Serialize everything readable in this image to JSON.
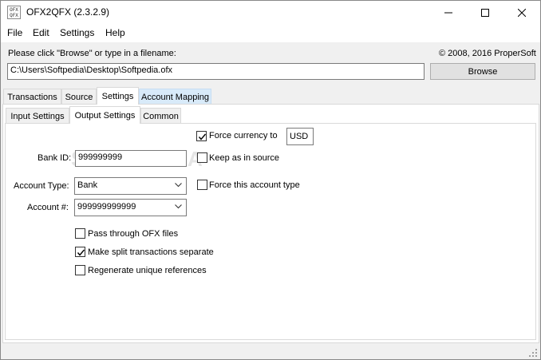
{
  "window": {
    "title": "OFX2QFX (2.3.2.9)",
    "icon_text_top": "OFX",
    "icon_text_bottom": "QFX"
  },
  "menu": [
    "File",
    "Edit",
    "Settings",
    "Help"
  ],
  "file": {
    "prompt": "Please click \"Browse\" or type in a filename:",
    "copyright": "© 2008, 2016 ProperSoft",
    "path": "C:\\Users\\Softpedia\\Desktop\\Softpedia.ofx",
    "browse_label": "Browse"
  },
  "main_tabs": [
    "Transactions",
    "Source",
    "Settings",
    "Account Mapping"
  ],
  "sub_tabs": [
    "Input Settings",
    "Output Settings",
    "Common"
  ],
  "output": {
    "force_currency_label": "Force currency to",
    "force_currency_checked": true,
    "currency_value": "USD",
    "bank_id_label": "Bank ID:",
    "bank_id_value": "999999999",
    "keep_source_label": "Keep as in source",
    "keep_source_checked": false,
    "account_type_label": "Account Type:",
    "account_type_value": "Bank",
    "force_account_type_label": "Force this account type",
    "force_account_type_checked": false,
    "account_num_label": "Account #:",
    "account_num_value": "999999999999",
    "pass_through_label": "Pass through OFX files",
    "pass_through_checked": false,
    "split_label": "Make split transactions separate",
    "split_checked": true,
    "regenerate_label": "Regenerate unique references",
    "regenerate_checked": false
  },
  "watermark": "SOFTPEDIA"
}
